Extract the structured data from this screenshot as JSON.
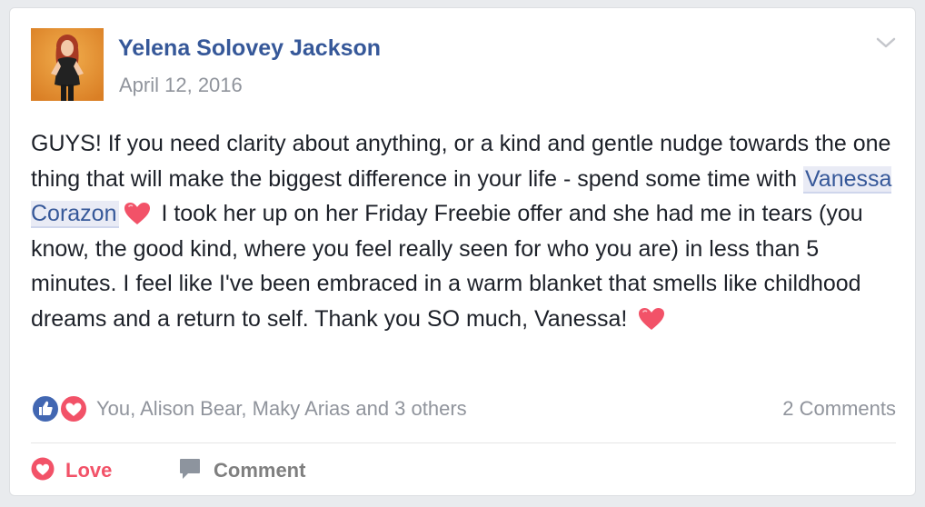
{
  "post": {
    "author": "Yelena Solovey Jackson",
    "date": "April 12, 2016",
    "text_part1": "GUYS! If you need clarity about anything, or a kind and gentle nudge towards the one thing that will make the biggest difference in your life - spend some time with ",
    "mention": "Vanessa Corazon",
    "text_part2": " I took her up on her Friday Freebie offer and she had me in tears (you know, the good kind, where you feel really seen for who you are) in less than 5 minutes. I feel like I've been embraced in a warm blanket that smells like childhood dreams and a return to self. Thank you SO much, Vanessa! ",
    "emoji_icon": "heart-icon"
  },
  "reactions": {
    "icons": [
      "like-icon",
      "love-icon"
    ],
    "names": "You, Alison Bear, Maky Arias and 3 others",
    "comments": "2 Comments"
  },
  "actions": {
    "love_label": "Love",
    "comment_label": "Comment"
  },
  "colors": {
    "name_blue": "#365899",
    "love_red": "#f25268",
    "like_blue": "#4267b2",
    "meta_grey": "#90949c"
  }
}
